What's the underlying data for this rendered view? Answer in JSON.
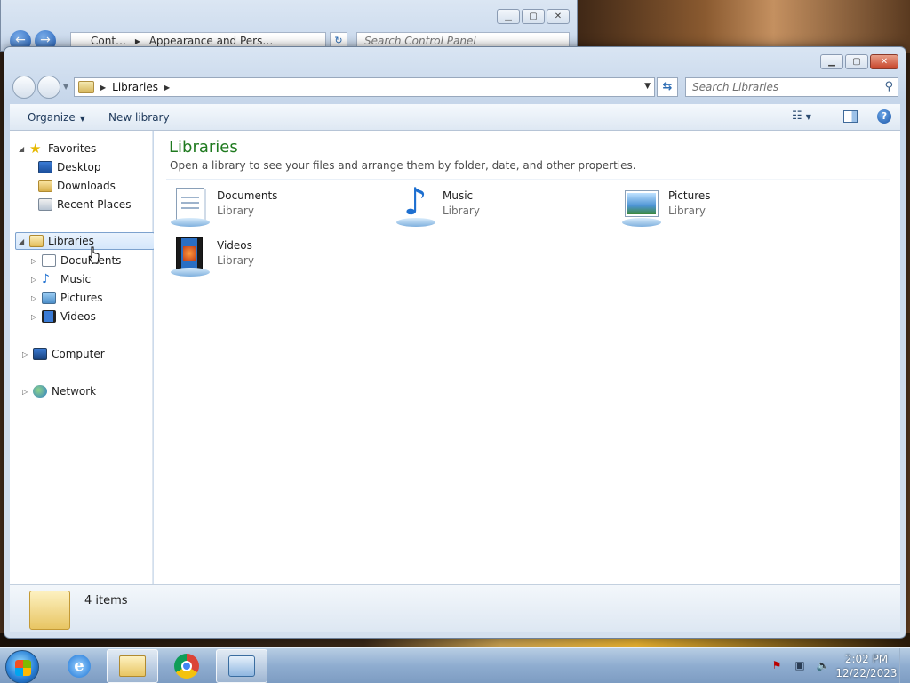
{
  "background_window": {
    "address_segments": [
      "Cont…",
      "Appearance and Pers…"
    ],
    "search_placeholder": "Search Control Panel"
  },
  "window": {
    "address": "Libraries",
    "search_placeholder": "Search Libraries",
    "toolbar": {
      "organize": "Organize",
      "new_library": "New library"
    },
    "sidebar": {
      "favorites": {
        "label": "Favorites",
        "items": [
          "Desktop",
          "Downloads",
          "Recent Places"
        ]
      },
      "libraries": {
        "label": "Libraries",
        "items": [
          "Documents",
          "Music",
          "Pictures",
          "Videos"
        ]
      },
      "computer": "Computer",
      "network": "Network"
    },
    "main": {
      "title": "Libraries",
      "description": "Open a library to see your files and arrange them by folder, date, and other properties.",
      "libraries": [
        {
          "name": "Documents",
          "type": "Library",
          "icon": "documents-library-icon"
        },
        {
          "name": "Music",
          "type": "Library",
          "icon": "music-library-icon"
        },
        {
          "name": "Pictures",
          "type": "Library",
          "icon": "pictures-library-icon"
        },
        {
          "name": "Videos",
          "type": "Library",
          "icon": "videos-library-icon"
        }
      ]
    },
    "details": {
      "count": "4 items"
    }
  },
  "taskbar": {
    "apps": [
      "internet-explorer-icon",
      "windows-explorer-icon",
      "chrome-icon",
      "control-panel-icon"
    ],
    "clock": {
      "time": "2:02 PM",
      "date": "12/22/2023"
    }
  },
  "colors": {
    "title_green": "#1f7a1f",
    "selection_border": "#7da2ce",
    "close_red": "#c7452a"
  }
}
